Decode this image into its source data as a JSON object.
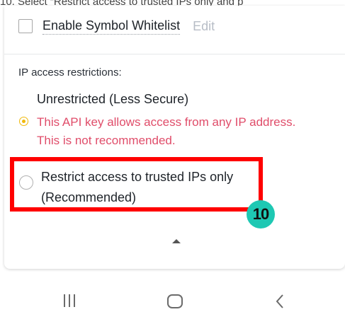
{
  "caption": "10.  Select “Restrict access to trusted IPs only and p",
  "whitelist": {
    "label": "Enable Symbol Whitelist",
    "edit_label": "Edit",
    "checked": false
  },
  "ip_section": {
    "title": "IP access restrictions:",
    "options": [
      {
        "label": "Unrestricted (Less Secure)",
        "selected": true,
        "warning_line1": "This API key allows access from any IP address.",
        "warning_line2": "This is not recommended."
      },
      {
        "label_line1": "Restrict access to trusted IPs only",
        "label_line2": "(Recommended)",
        "selected": false
      }
    ]
  },
  "annotation": {
    "step_number": "10",
    "box_color": "#ff0000",
    "badge_color": "#1ec8b3"
  },
  "colors": {
    "accent_yellow": "#f0b90b",
    "warning_red": "#e04d6a",
    "text_primary": "#1e2329"
  },
  "icons": {
    "collapse": "chevron-up-icon",
    "nav_recents": "recents-icon",
    "nav_home": "home-icon",
    "nav_back": "back-icon"
  }
}
